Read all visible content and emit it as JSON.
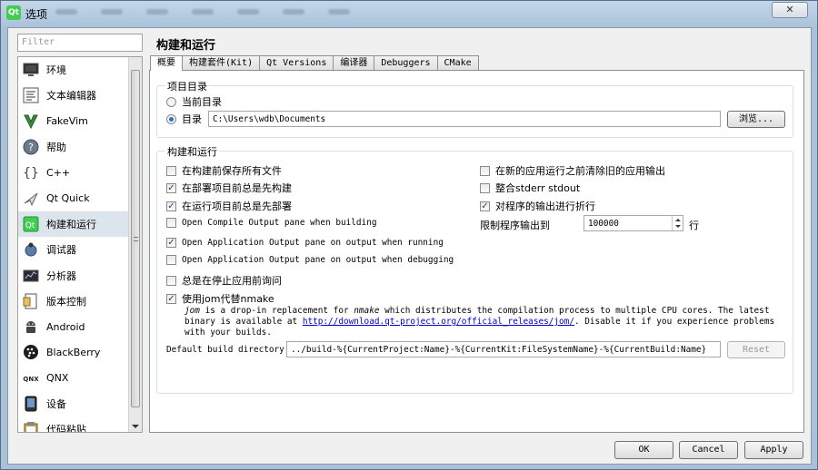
{
  "window": {
    "title": "选项",
    "app_icon": "Qt",
    "close_label": "✕"
  },
  "filter": {
    "placeholder": "Filter"
  },
  "categories": [
    {
      "label": "环境",
      "icon": "monitor-icon"
    },
    {
      "label": "文本编辑器",
      "icon": "text-editor-icon"
    },
    {
      "label": "FakeVim",
      "icon": "fakevim-icon"
    },
    {
      "label": "帮助",
      "icon": "help-icon"
    },
    {
      "label": "C++",
      "icon": "cpp-braces-icon"
    },
    {
      "label": "Qt Quick",
      "icon": "qt-quick-icon"
    },
    {
      "label": "构建和运行",
      "icon": "build-run-icon",
      "selected": true
    },
    {
      "label": "调试器",
      "icon": "debugger-icon"
    },
    {
      "label": "分析器",
      "icon": "analyzer-icon"
    },
    {
      "label": "版本控制",
      "icon": "version-control-icon"
    },
    {
      "label": "Android",
      "icon": "android-icon"
    },
    {
      "label": "BlackBerry",
      "icon": "blackberry-icon"
    },
    {
      "label": "QNX",
      "icon": "qnx-icon"
    },
    {
      "label": "设备",
      "icon": "device-icon"
    },
    {
      "label": "代码粘贴",
      "icon": "code-paste-icon"
    }
  ],
  "page": {
    "title": "构建和运行"
  },
  "tabs": [
    "概要",
    "构建套件(Kit)",
    "Qt Versions",
    "编译器",
    "Debuggers",
    "CMake"
  ],
  "project_dir": {
    "title": "项目目录",
    "current_dir_label": "当前目录",
    "dir_label": "目录",
    "dir_value": "C:\\Users\\wdb\\Documents",
    "browse_label": "浏览..."
  },
  "build_run": {
    "title": "构建和运行",
    "options": [
      {
        "label": "在构建前保存所有文件",
        "checked": false
      },
      {
        "label": "在部署项目前总是先构建",
        "checked": true
      },
      {
        "label": "在运行项目前总是先部署",
        "checked": true
      },
      {
        "label": "Open Compile Output pane when building",
        "checked": false
      },
      {
        "label": "Open Application Output pane on output when running",
        "checked": true
      },
      {
        "label": "Open Application Output pane on output when debugging",
        "checked": false
      },
      {
        "label": "总是在停止应用前询问",
        "checked": false
      },
      {
        "label": "使用jom代替nmake",
        "checked": true
      }
    ],
    "right_options": [
      {
        "label": "在新的应用运行之前清除旧的应用输出",
        "checked": false
      },
      {
        "label": "整合stderr stdout",
        "checked": false
      },
      {
        "label": "对程序的输出进行折行",
        "checked": true
      }
    ],
    "limit_label": "限制程序输出到",
    "limit_value": "100000",
    "limit_unit": "行",
    "jom_desc": {
      "jom": "jom",
      "p1": " is a drop-in replacement for ",
      "nmake": "nmake",
      "p2": " which distributes the compilation process to multiple CPU cores. The latest binary is available at ",
      "link": "http://download.qt-project.org/official_releases/jom/",
      "p3": ". Disable it if you experience problems with your builds."
    },
    "default_dir_label": "Default build directory:",
    "default_dir_value": "../build-%{CurrentProject:Name}-%{CurrentKit:FileSystemName}-%{CurrentBuild:Name}",
    "reset_label": "Reset"
  },
  "buttons": {
    "ok": "OK",
    "cancel": "Cancel",
    "apply": "Apply"
  },
  "colors": {
    "selection": "#dde5ec",
    "link": "#0000cc",
    "qt_green": "#41cd52"
  }
}
